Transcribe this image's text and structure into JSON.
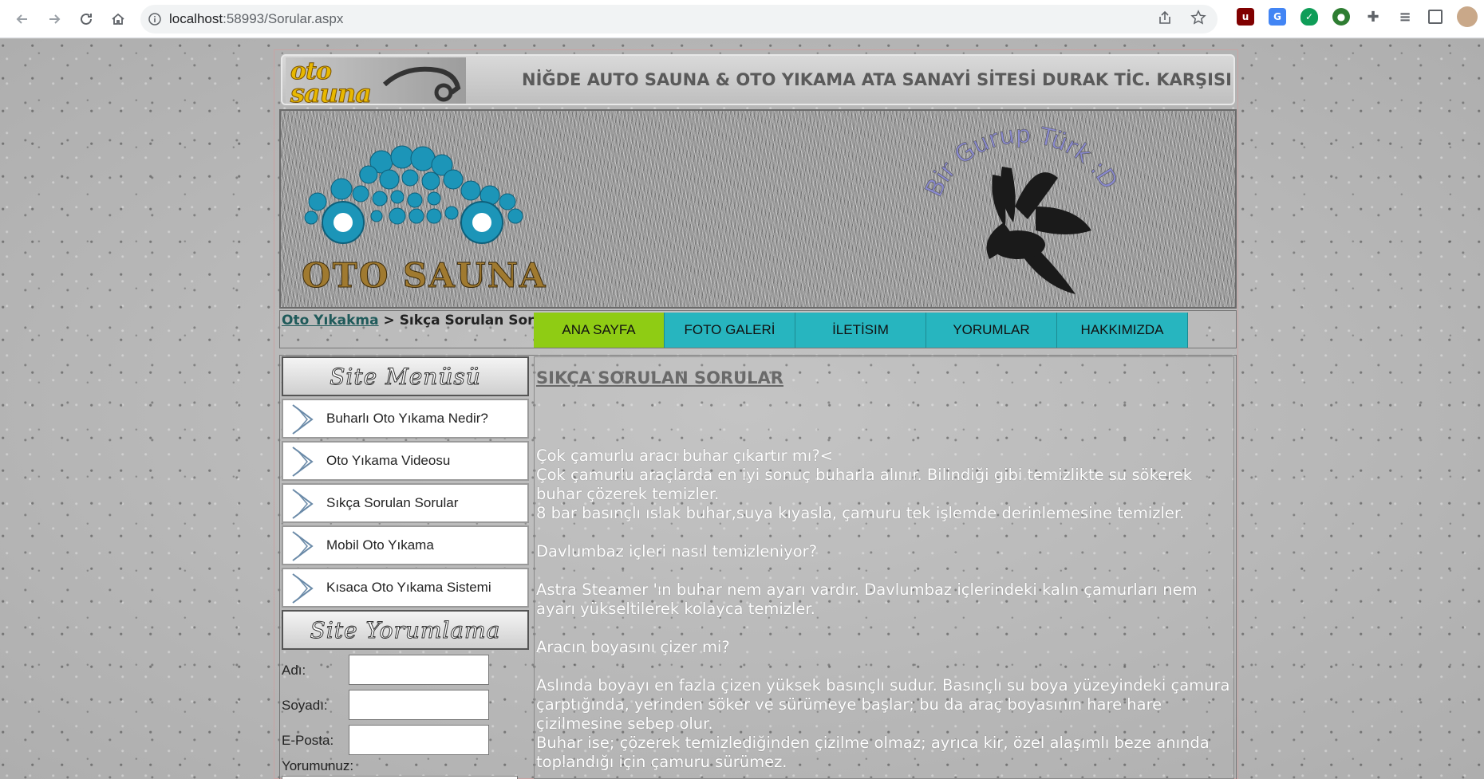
{
  "browser": {
    "url_host": "localhost",
    "url_rest": ":58993/Sorular.aspx"
  },
  "site": {
    "logo_top": "oto",
    "logo_bottom": "sauna",
    "marquee": "NİĞDE AUTO SAUNA & OTO YIKAMA ATA SANAYİ SİTESİ DURAK TİC. KARŞISI Telefo",
    "banner_title": "OTO SAUNA",
    "banner_arc_text": "Bir Gurup Türk :D"
  },
  "breadcrumb": {
    "link": "Oto Yıkakma",
    "separator": " > ",
    "current": "Sıkça Sorulan Sorular"
  },
  "menu": [
    {
      "label": "ANA SAYFA",
      "active": true
    },
    {
      "label": "FOTO GALERİ",
      "active": false
    },
    {
      "label": "İLETİSIM",
      "active": false
    },
    {
      "label": "YORUMLAR",
      "active": false
    },
    {
      "label": "HAKKIMIZDA",
      "active": false
    }
  ],
  "sidebar": {
    "menu_title": "Site Menüsü",
    "items": [
      {
        "label": "Buharlı Oto Yıkama Nedir?"
      },
      {
        "label": "Oto Yıkama Videosu"
      },
      {
        "label": "Sıkça Sorulan Sorular"
      },
      {
        "label": "Mobil Oto Yıkama"
      },
      {
        "label": "Kısaca Oto Yıkama Sistemi"
      }
    ],
    "comment_title": "Site Yorumlama",
    "form": {
      "name_label": "Adı:",
      "surname_label": "Soyadı:",
      "email_label": "E-Posta:",
      "comment_label": "Yorumunuz:"
    }
  },
  "content": {
    "heading": "SIKÇA SORULAN SORULAR",
    "paragraphs": [
      "Çok çamurlu aracı buhar çıkartır mı?<",
      "Çok çamurlu araçlarda en iyi sonuç buharla alınır. Bilindiği gibi temizlikte su sökerek buhar çözerek temizler.",
      "8 bar basınçlı ıslak buhar,suya kıyasla, çamuru tek işlemde derinlemesine temizler.",
      "",
      "Davlumbaz içleri nasıl temizleniyor?",
      "",
      "Astra Steamer 'ın buhar nem ayarı vardır. Davlumbaz içlerindeki kalın çamurları nem ayarı yükseltilerek kolayca temizler.",
      "",
      "Aracın boyasını çizer mi?",
      "",
      "Aslında boyayı en fazla çizen yüksek basınçlı sudur. Basınçlı su boya yüzeyindeki çamura çarptığında, yerinden söker ve sürümeye başlar; bu da araç boyasının hare hare çizilmesine sebep olur.",
      "Buhar ise; çözerek temizlediğinden çizilme olmaz; ayrıca kir, özel alaşımlı beze anında toplandığı için çamuru sürümez."
    ]
  },
  "colors": {
    "menu_bg": "#27b5bf",
    "menu_active": "#8fcc14",
    "link": "#1f5a5a"
  }
}
